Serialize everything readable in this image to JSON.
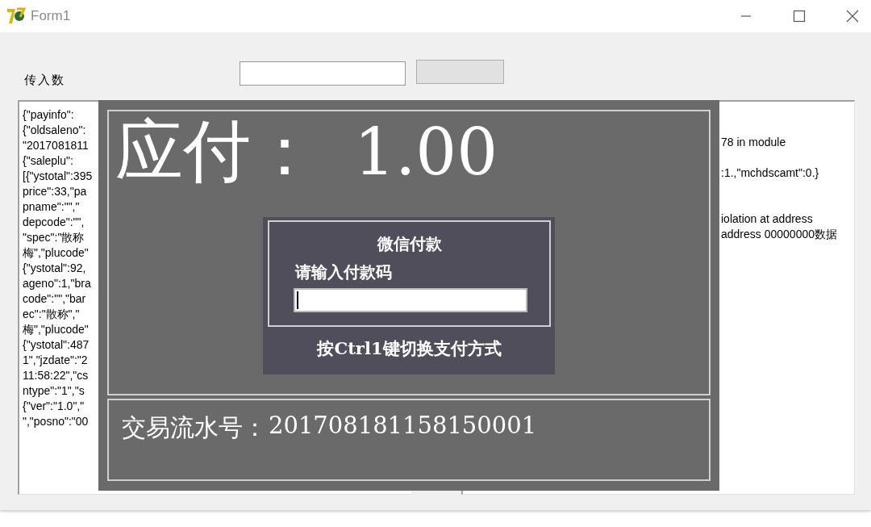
{
  "window": {
    "title": "Form1"
  },
  "input_label": "传入数",
  "input_lines": [
    "{\"payinfo\":",
    "{\"oldsaleno\":",
    "\"2017081811",
    "{\"saleplu\":",
    "[{\"ystotal\":395",
    "price\":33,\"pa",
    "pname\":\"\",\"",
    "depcode\":\"\",",
    "\"spec\":\"散称",
    "梅\",\"plucode\"",
    "{\"ystotal\":92,",
    "ageno\":1,\"bra",
    "code\":\"\",\"bar",
    "ec\":\"散称\",\"",
    "梅\",\"plucode\"",
    "{\"ystotal\":487",
    "1\",\"jzdate\":\"2",
    "11:58:22\",\"cs",
    "ntype\":\"1\",\"s",
    "{\"ver\":\"1.0\",\"",
    "\",\"posno\":\"00"
  ],
  "output_lines": [
    "78 in module",
    ":1.,\"mchdscamt\":0.}",
    "iolation at address",
    "address 00000000数据"
  ],
  "payment_dialog": {
    "amount_label": "应付：",
    "amount": "1.00",
    "method_title": "微信付款",
    "code_label": "请输入付款码",
    "switch_hint": "按Ctrl1键切换支付方式",
    "serial_label": "交易流水号：",
    "serial_number": "201708181158150001"
  }
}
